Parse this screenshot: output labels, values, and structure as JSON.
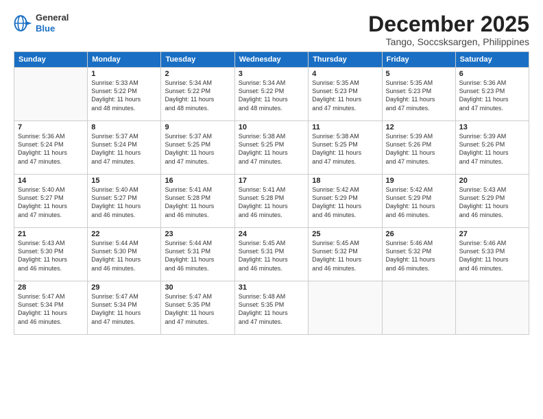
{
  "logo": {
    "line1": "General",
    "line2": "Blue"
  },
  "title": "December 2025",
  "subtitle": "Tango, Soccsksargen, Philippines",
  "headers": [
    "Sunday",
    "Monday",
    "Tuesday",
    "Wednesday",
    "Thursday",
    "Friday",
    "Saturday"
  ],
  "weeks": [
    [
      {
        "day": "",
        "info": ""
      },
      {
        "day": "1",
        "info": "Sunrise: 5:33 AM\nSunset: 5:22 PM\nDaylight: 11 hours\nand 48 minutes."
      },
      {
        "day": "2",
        "info": "Sunrise: 5:34 AM\nSunset: 5:22 PM\nDaylight: 11 hours\nand 48 minutes."
      },
      {
        "day": "3",
        "info": "Sunrise: 5:34 AM\nSunset: 5:22 PM\nDaylight: 11 hours\nand 48 minutes."
      },
      {
        "day": "4",
        "info": "Sunrise: 5:35 AM\nSunset: 5:23 PM\nDaylight: 11 hours\nand 47 minutes."
      },
      {
        "day": "5",
        "info": "Sunrise: 5:35 AM\nSunset: 5:23 PM\nDaylight: 11 hours\nand 47 minutes."
      },
      {
        "day": "6",
        "info": "Sunrise: 5:36 AM\nSunset: 5:23 PM\nDaylight: 11 hours\nand 47 minutes."
      }
    ],
    [
      {
        "day": "7",
        "info": "Sunrise: 5:36 AM\nSunset: 5:24 PM\nDaylight: 11 hours\nand 47 minutes."
      },
      {
        "day": "8",
        "info": "Sunrise: 5:37 AM\nSunset: 5:24 PM\nDaylight: 11 hours\nand 47 minutes."
      },
      {
        "day": "9",
        "info": "Sunrise: 5:37 AM\nSunset: 5:25 PM\nDaylight: 11 hours\nand 47 minutes."
      },
      {
        "day": "10",
        "info": "Sunrise: 5:38 AM\nSunset: 5:25 PM\nDaylight: 11 hours\nand 47 minutes."
      },
      {
        "day": "11",
        "info": "Sunrise: 5:38 AM\nSunset: 5:25 PM\nDaylight: 11 hours\nand 47 minutes."
      },
      {
        "day": "12",
        "info": "Sunrise: 5:39 AM\nSunset: 5:26 PM\nDaylight: 11 hours\nand 47 minutes."
      },
      {
        "day": "13",
        "info": "Sunrise: 5:39 AM\nSunset: 5:26 PM\nDaylight: 11 hours\nand 47 minutes."
      }
    ],
    [
      {
        "day": "14",
        "info": "Sunrise: 5:40 AM\nSunset: 5:27 PM\nDaylight: 11 hours\nand 47 minutes."
      },
      {
        "day": "15",
        "info": "Sunrise: 5:40 AM\nSunset: 5:27 PM\nDaylight: 11 hours\nand 46 minutes."
      },
      {
        "day": "16",
        "info": "Sunrise: 5:41 AM\nSunset: 5:28 PM\nDaylight: 11 hours\nand 46 minutes."
      },
      {
        "day": "17",
        "info": "Sunrise: 5:41 AM\nSunset: 5:28 PM\nDaylight: 11 hours\nand 46 minutes."
      },
      {
        "day": "18",
        "info": "Sunrise: 5:42 AM\nSunset: 5:29 PM\nDaylight: 11 hours\nand 46 minutes."
      },
      {
        "day": "19",
        "info": "Sunrise: 5:42 AM\nSunset: 5:29 PM\nDaylight: 11 hours\nand 46 minutes."
      },
      {
        "day": "20",
        "info": "Sunrise: 5:43 AM\nSunset: 5:29 PM\nDaylight: 11 hours\nand 46 minutes."
      }
    ],
    [
      {
        "day": "21",
        "info": "Sunrise: 5:43 AM\nSunset: 5:30 PM\nDaylight: 11 hours\nand 46 minutes."
      },
      {
        "day": "22",
        "info": "Sunrise: 5:44 AM\nSunset: 5:30 PM\nDaylight: 11 hours\nand 46 minutes."
      },
      {
        "day": "23",
        "info": "Sunrise: 5:44 AM\nSunset: 5:31 PM\nDaylight: 11 hours\nand 46 minutes."
      },
      {
        "day": "24",
        "info": "Sunrise: 5:45 AM\nSunset: 5:31 PM\nDaylight: 11 hours\nand 46 minutes."
      },
      {
        "day": "25",
        "info": "Sunrise: 5:45 AM\nSunset: 5:32 PM\nDaylight: 11 hours\nand 46 minutes."
      },
      {
        "day": "26",
        "info": "Sunrise: 5:46 AM\nSunset: 5:32 PM\nDaylight: 11 hours\nand 46 minutes."
      },
      {
        "day": "27",
        "info": "Sunrise: 5:46 AM\nSunset: 5:33 PM\nDaylight: 11 hours\nand 46 minutes."
      }
    ],
    [
      {
        "day": "28",
        "info": "Sunrise: 5:47 AM\nSunset: 5:34 PM\nDaylight: 11 hours\nand 46 minutes."
      },
      {
        "day": "29",
        "info": "Sunrise: 5:47 AM\nSunset: 5:34 PM\nDaylight: 11 hours\nand 47 minutes."
      },
      {
        "day": "30",
        "info": "Sunrise: 5:47 AM\nSunset: 5:35 PM\nDaylight: 11 hours\nand 47 minutes."
      },
      {
        "day": "31",
        "info": "Sunrise: 5:48 AM\nSunset: 5:35 PM\nDaylight: 11 hours\nand 47 minutes."
      },
      {
        "day": "",
        "info": ""
      },
      {
        "day": "",
        "info": ""
      },
      {
        "day": "",
        "info": ""
      }
    ]
  ]
}
